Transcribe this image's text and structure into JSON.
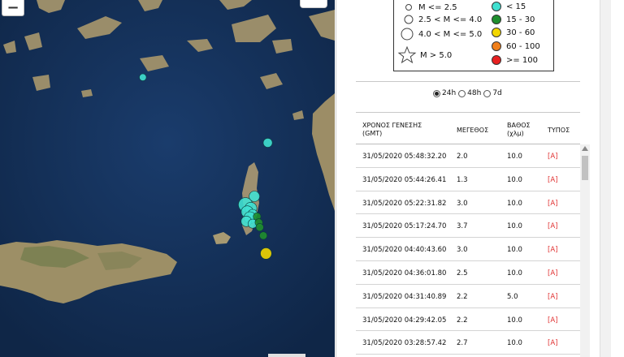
{
  "map": {
    "zoom_out_label": "−",
    "ocean_color": "#14305a",
    "land_color": "#a89870",
    "events_depth_lt15": [
      {
        "lat": 36.4,
        "lon": 27.35,
        "mag": 2.0
      },
      {
        "lat": 35.95,
        "lon": 27.2,
        "mag": 2.5
      },
      {
        "lat": 35.88,
        "lon": 27.1,
        "mag": 3.7
      },
      {
        "lat": 35.85,
        "lon": 27.16,
        "mag": 3.0
      },
      {
        "lat": 35.82,
        "lon": 27.12,
        "mag": 3.0
      },
      {
        "lat": 35.8,
        "lon": 27.18,
        "mag": 2.2
      },
      {
        "lat": 35.77,
        "lon": 27.15,
        "mag": 3.0
      },
      {
        "lat": 35.74,
        "lon": 27.11,
        "mag": 2.5
      },
      {
        "lat": 35.72,
        "lon": 27.18,
        "mag": 2.0
      },
      {
        "lat": 36.95,
        "lon": 25.95,
        "mag": 1.3
      }
    ],
    "events_depth_15_30": [
      {
        "lat": 35.78,
        "lon": 27.23,
        "mag": 1.5
      },
      {
        "lat": 35.73,
        "lon": 27.25,
        "mag": 1.5
      },
      {
        "lat": 35.69,
        "lon": 27.26,
        "mag": 1.5
      },
      {
        "lat": 35.62,
        "lon": 27.3,
        "mag": 1.5
      }
    ],
    "events_depth_30_60": [
      {
        "lat": 35.47,
        "lon": 27.33,
        "mag": 2.7
      }
    ]
  },
  "legend": {
    "magnitude": [
      {
        "label": "M <= 2.5",
        "size": 7
      },
      {
        "label": "2.5 < M <= 4.0",
        "size": 10
      },
      {
        "label": "4.0 < M <= 5.0",
        "size": 14
      },
      {
        "label": "M > 5.0",
        "shape": "star"
      }
    ],
    "depth": [
      {
        "label": "< 15",
        "color": "#40e0d0"
      },
      {
        "label": "15 - 30",
        "color": "#1f8f2e"
      },
      {
        "label": "30 - 60",
        "color": "#f2d600"
      },
      {
        "label": "60 - 100",
        "color": "#f07f1a"
      },
      {
        "label": ">= 100",
        "color": "#e82020"
      }
    ]
  },
  "period": {
    "options": [
      "24h",
      "48h",
      "7d"
    ],
    "selected": "24h"
  },
  "table": {
    "headers": {
      "time_line1": "ΧΡΟΝΟΣ ΓΕΝΕΣΗΣ",
      "time_line2": "(GMT)",
      "magnitude": "ΜΕΓΕΘΟΣ",
      "depth_line1": "ΒΑΘΟΣ",
      "depth_line2": "(χλμ)",
      "type": "ΤΥΠΟΣ"
    },
    "rows": [
      {
        "time": "31/05/2020 05:48:32.20",
        "mag": "2.0",
        "depth": "10.0",
        "type": "[A]"
      },
      {
        "time": "31/05/2020 05:44:26.41",
        "mag": "1.3",
        "depth": "10.0",
        "type": "[A]"
      },
      {
        "time": "31/05/2020 05:22:31.82",
        "mag": "3.0",
        "depth": "10.0",
        "type": "[A]"
      },
      {
        "time": "31/05/2020 05:17:24.70",
        "mag": "3.7",
        "depth": "10.0",
        "type": "[A]"
      },
      {
        "time": "31/05/2020 04:40:43.60",
        "mag": "3.0",
        "depth": "10.0",
        "type": "[A]"
      },
      {
        "time": "31/05/2020 04:36:01.80",
        "mag": "2.5",
        "depth": "10.0",
        "type": "[A]"
      },
      {
        "time": "31/05/2020 04:31:40.89",
        "mag": "2.2",
        "depth": "5.0",
        "type": "[A]"
      },
      {
        "time": "31/05/2020 04:29:42.05",
        "mag": "2.2",
        "depth": "10.0",
        "type": "[A]"
      },
      {
        "time": "31/05/2020 03:28:57.42",
        "mag": "2.7",
        "depth": "10.0",
        "type": "[A]"
      }
    ]
  }
}
